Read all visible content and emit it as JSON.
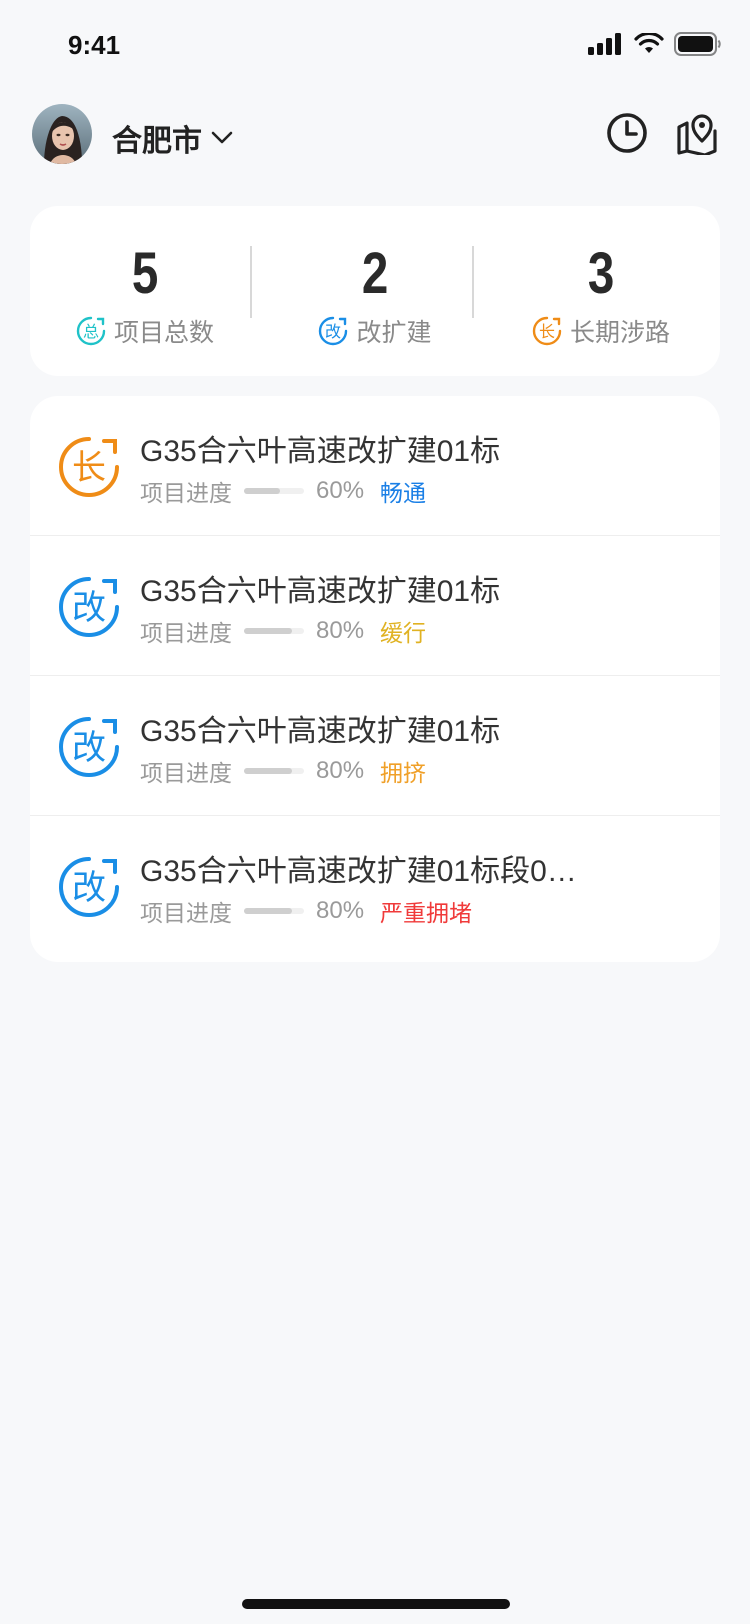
{
  "status_bar": {
    "time": "9:41"
  },
  "header": {
    "city": "合肥市"
  },
  "stats": [
    {
      "value": "5",
      "label": "项目总数",
      "badge": "总",
      "color": "#1fc2c8"
    },
    {
      "value": "2",
      "label": "改扩建",
      "badge": "改",
      "color": "#1a8ee6"
    },
    {
      "value": "3",
      "label": "长期涉路",
      "badge": "长",
      "color": "#ef8c17"
    }
  ],
  "projects": [
    {
      "badge": "长",
      "badge_color": "#ef8c17",
      "title": "G35合六叶高速改扩建01标",
      "progress_label": "项目进度",
      "progress": 0.6,
      "percent": "60%",
      "status": "畅通",
      "status_color": "#1a7fe6"
    },
    {
      "badge": "改",
      "badge_color": "#1a8ee6",
      "title": "G35合六叶高速改扩建01标",
      "progress_label": "项目进度",
      "progress": 0.8,
      "percent": "80%",
      "status": "缓行",
      "status_color": "#e0b222"
    },
    {
      "badge": "改",
      "badge_color": "#1a8ee6",
      "title": "G35合六叶高速改扩建01标",
      "progress_label": "项目进度",
      "progress": 0.8,
      "percent": "80%",
      "status": "拥挤",
      "status_color": "#f0a028"
    },
    {
      "badge": "改",
      "badge_color": "#1a8ee6",
      "title": "G35合六叶高速改扩建01标段0…",
      "progress_label": "项目进度",
      "progress": 0.8,
      "percent": "80%",
      "status": "严重拥堵",
      "status_color": "#f03a3a"
    }
  ],
  "icons": {
    "history": "clock-icon",
    "map": "map-pin-icon",
    "dropdown": "chevron-down-icon"
  }
}
